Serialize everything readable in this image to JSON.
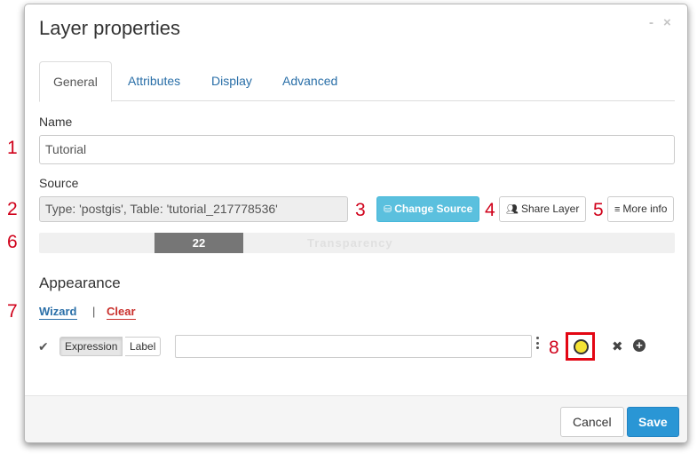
{
  "annotations": [
    "1",
    "2",
    "3",
    "4",
    "5",
    "6",
    "7",
    "8"
  ],
  "dialog": {
    "title": "Layer properties",
    "minimize_glyph": "-",
    "close_glyph": "×"
  },
  "tabs": [
    {
      "label": "General",
      "active": true
    },
    {
      "label": "Attributes",
      "active": false
    },
    {
      "label": "Display",
      "active": false
    },
    {
      "label": "Advanced",
      "active": false
    }
  ],
  "general": {
    "name_label": "Name",
    "name_value": "Tutorial",
    "source_label": "Source",
    "source_value": "Type: 'postgis', Table: 'tutorial_217778536'",
    "change_source_label": "Change Source",
    "share_layer_label": "Share Layer",
    "more_info_label": "More info",
    "transparency": {
      "value": "22",
      "label": "Transparency"
    }
  },
  "appearance": {
    "title": "Appearance",
    "wizard_label": "Wizard",
    "separator": "|",
    "clear_label": "Clear",
    "rule": {
      "expression_label": "Expression",
      "label_label": "Label",
      "expression_value": "",
      "style_fill_color": "#f5e335",
      "style_stroke_color": "#333333"
    }
  },
  "footer": {
    "cancel_label": "Cancel",
    "save_label": "Save"
  },
  "colors": {
    "annotation": "#d0021b",
    "link": "#2a6fa8",
    "clear": "#c9302c",
    "info_button": "#5bc0de",
    "primary_button": "#2a96d5",
    "highlight_box": "#e30613"
  },
  "icons": {
    "change_source": "database-icon",
    "share_layer": "users-icon",
    "more_info": "list-icon",
    "rule_check": "check-icon",
    "rule_menu": "kebab-icon",
    "rule_remove": "close-icon",
    "rule_add": "plus-circle-icon"
  }
}
